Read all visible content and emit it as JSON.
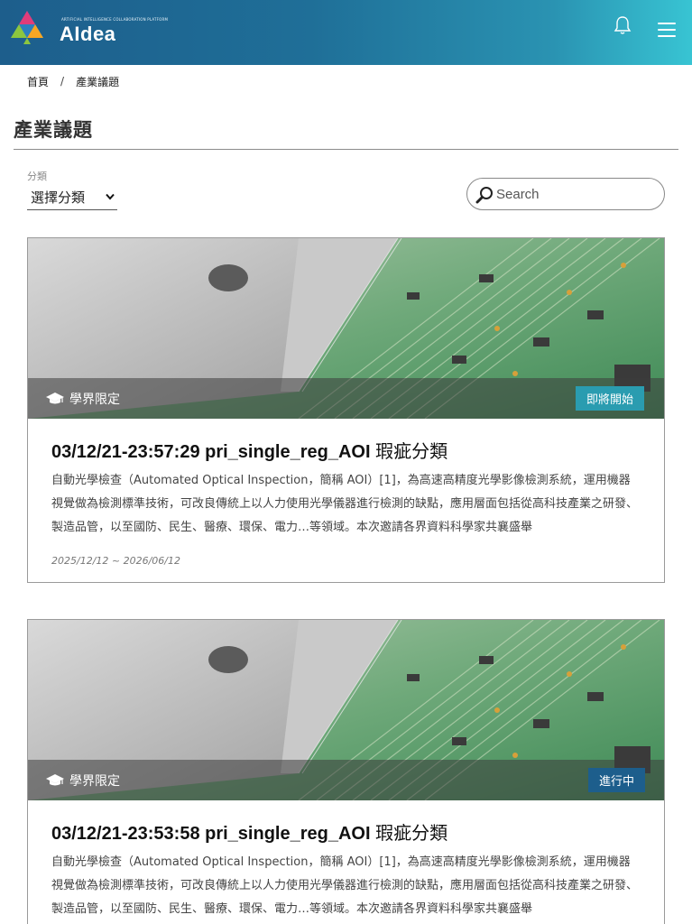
{
  "header": {
    "logo_tagline": "ARTIFICIAL INTELLIGENCE COLLABORATION PLATFORM",
    "logo_text": "AIdea",
    "icons": {
      "notification": "bell-icon",
      "menu": "hamburger-menu-icon"
    },
    "colors": {
      "gradient_start": "#1d5e8c",
      "gradient_end": "#38c4d3"
    }
  },
  "breadcrumb": {
    "home": "首頁",
    "separator": "/",
    "current": "產業議題"
  },
  "page": {
    "title": "產業議題"
  },
  "filter": {
    "label": "分類",
    "selected": "選擇分類"
  },
  "search": {
    "placeholder": "Search",
    "icon": "search-icon"
  },
  "cards": [
    {
      "restriction": "學界限定",
      "status": "即將開始",
      "status_color": "#2a9cb0",
      "title_code": "03/12/21-23:57:29 pri_single_reg_AOI",
      "title_zh": "瑕疵分類",
      "description": "自動光學檢查（Automated Optical Inspection，簡稱 AOI）[1]，為高速高精度光學影像檢測系統，運用機器視覺做為檢測標準技術，可改良傳統上以人力使用光學儀器進行檢測的缺點，應用層面包括從高科技產業之研發、製造品管，以至國防、民生、醫療、環保、電力…等領域。本次邀請各界資料科學家共襄盛舉",
      "date_range": "2025/12/12 ~ 2026/06/12"
    },
    {
      "restriction": "學界限定",
      "status": "進行中",
      "status_color": "#1d5e8c",
      "title_code": "03/12/21-23:53:58 pri_single_reg_AOI",
      "title_zh": "瑕疵分類",
      "description": "自動光學檢查（Automated Optical Inspection，簡稱 AOI）[1]，為高速高精度光學影像檢測系統，運用機器視覺做為檢測標準技術，可改良傳統上以人力使用光學儀器進行檢測的缺點，應用層面包括從高科技產業之研發、製造品管，以至國防、民生、醫療、環保、電力…等領域。本次邀請各界資料科學家共襄盛舉"
    }
  ]
}
